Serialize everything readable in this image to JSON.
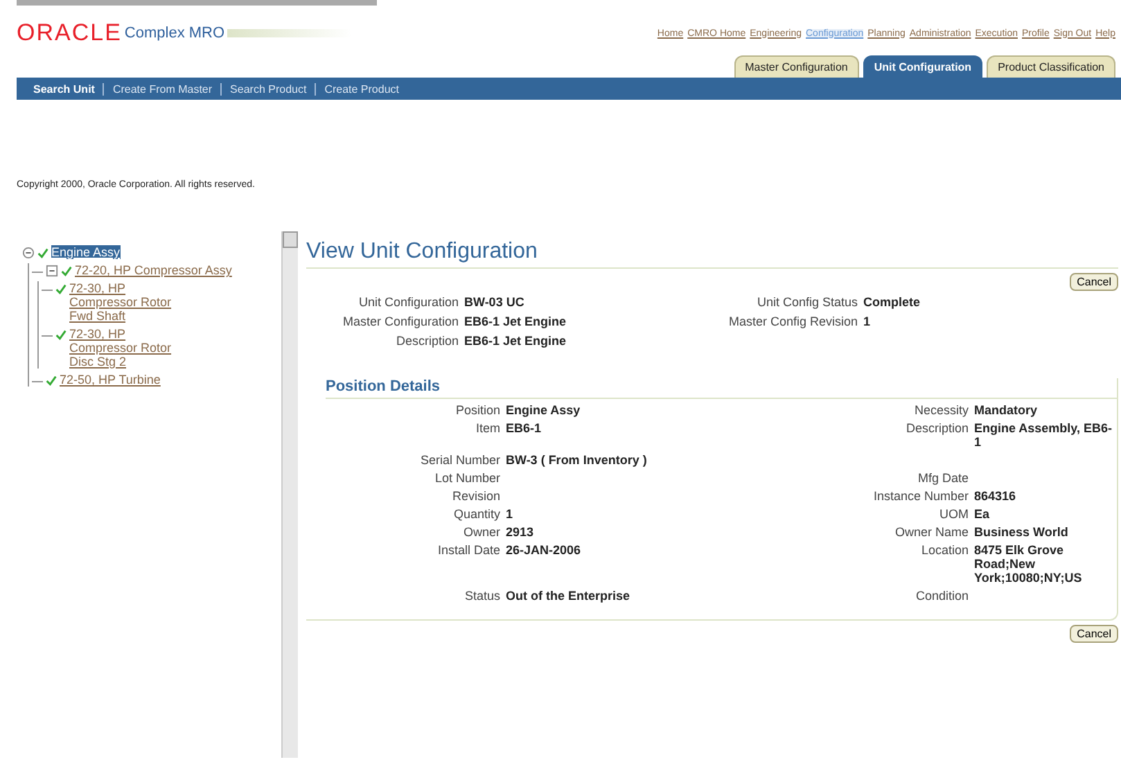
{
  "brand": {
    "logo": "ORACLE",
    "product": "Complex MRO"
  },
  "global_links": [
    {
      "label": "Home",
      "selected": false
    },
    {
      "label": "CMRO Home",
      "selected": false
    },
    {
      "label": "Engineering",
      "selected": false
    },
    {
      "label": "Configuration",
      "selected": true
    },
    {
      "label": "Planning",
      "selected": false
    },
    {
      "label": "Administration",
      "selected": false
    },
    {
      "label": "Execution",
      "selected": false
    },
    {
      "label": "Profile",
      "selected": false
    },
    {
      "label": "Sign Out",
      "selected": false
    },
    {
      "label": "Help",
      "selected": false
    }
  ],
  "tabs": [
    {
      "label": "Master Configuration",
      "selected": false
    },
    {
      "label": "Unit Configuration",
      "selected": true
    },
    {
      "label": "Product Classification",
      "selected": false
    }
  ],
  "subnav": [
    {
      "label": "Search Unit",
      "selected": true
    },
    {
      "label": "Create From Master",
      "selected": false
    },
    {
      "label": "Search Product",
      "selected": false
    },
    {
      "label": "Create Product",
      "selected": false
    }
  ],
  "copyright": "Copyright 2000, Oracle Corporation. All rights reserved.",
  "tree": [
    {
      "label": "Engine Assy",
      "selected": true,
      "expanded": true,
      "checked": true,
      "children": [
        {
          "label": "72-20, HP Compressor Assy",
          "selected": false,
          "expanded": true,
          "checked": true,
          "children": [
            {
              "label": "72-30, HP Compressor Rotor Fwd Shaft",
              "selected": false,
              "checked": true
            },
            {
              "label": "72-30, HP Compressor Rotor Disc Stg 2",
              "selected": false,
              "checked": true
            }
          ]
        },
        {
          "label": "72-50, HP Turbine",
          "selected": false,
          "checked": true
        }
      ]
    }
  ],
  "page_title": "View Unit Configuration",
  "buttons": [
    "Cancel",
    "Cancel"
  ],
  "header_fields": [
    {
      "left": {
        "label": "Unit Configuration",
        "value": "BW-03 UC"
      },
      "right": {
        "label": "Unit Config Status",
        "value": "Complete"
      }
    },
    {
      "left": {
        "label": "Master Configuration",
        "value": "EB6-1 Jet Engine"
      },
      "right": {
        "label": "Master Config Revision",
        "value": "1"
      }
    },
    {
      "left": {
        "label": "Description",
        "value": "EB6-1 Jet Engine"
      }
    }
  ],
  "section_title": "Position Details",
  "position_fields": [
    {
      "left": {
        "label": "Position",
        "value": "Engine Assy"
      },
      "right": {
        "label": "Necessity",
        "value": "Mandatory"
      }
    },
    {
      "left": {
        "label": "Item",
        "value": "EB6-1"
      },
      "right": {
        "label": "Description",
        "value": "Engine Assembly, EB6-1"
      }
    },
    {
      "left": {
        "label": "Serial Number",
        "value": "BW-3  ( From Inventory )"
      }
    },
    {
      "left": {
        "label": "Lot Number"
      },
      "right": {
        "label": "Mfg Date"
      }
    },
    {
      "left": {
        "label": "Revision"
      },
      "right": {
        "label": "Instance Number",
        "value": "864316"
      }
    },
    {
      "left": {
        "label": "Quantity",
        "value": "1"
      },
      "right": {
        "label": "UOM",
        "value": "Ea"
      }
    },
    {
      "left": {
        "label": "Owner",
        "value": "2913"
      },
      "right": {
        "label": "Owner Name",
        "value": "Business World"
      }
    },
    {
      "left": {
        "label": "Install Date",
        "value": "26-JAN-2006"
      },
      "right": {
        "label": "Location",
        "value": "8475 Elk Grove Road;New York;10080;NY;US"
      }
    },
    {
      "left": {
        "label": "Status",
        "value": "Out of the Enterprise"
      },
      "right": {
        "label": "Condition"
      }
    }
  ]
}
